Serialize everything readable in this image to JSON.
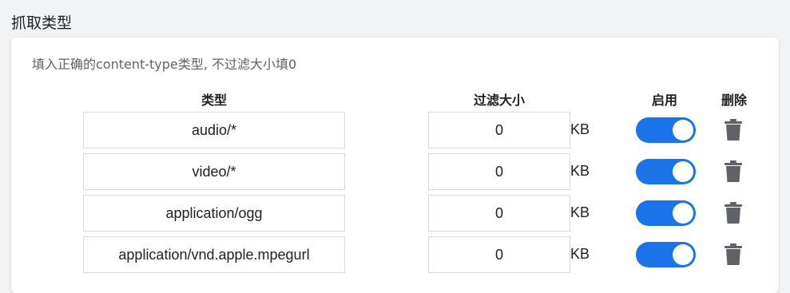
{
  "section": {
    "title": "抓取类型"
  },
  "hint": "填入正确的content-type类型, 不过滤大小填0",
  "headers": {
    "type": "类型",
    "size": "过滤大小",
    "enable": "启用",
    "delete": "删除"
  },
  "rows": [
    {
      "type": "audio/*",
      "size": "0",
      "unit": "KB",
      "enabled": true
    },
    {
      "type": "video/*",
      "size": "0",
      "unit": "KB",
      "enabled": true
    },
    {
      "type": "application/ogg",
      "size": "0",
      "unit": "KB",
      "enabled": true
    },
    {
      "type": "application/vnd.apple.mpegurl",
      "size": "0",
      "unit": "KB",
      "enabled": true
    }
  ],
  "colors": {
    "accent": "#1a73e8",
    "icon": "#5f6368",
    "border": "#d7d9dc"
  },
  "icons": {
    "delete": "trash-icon"
  }
}
